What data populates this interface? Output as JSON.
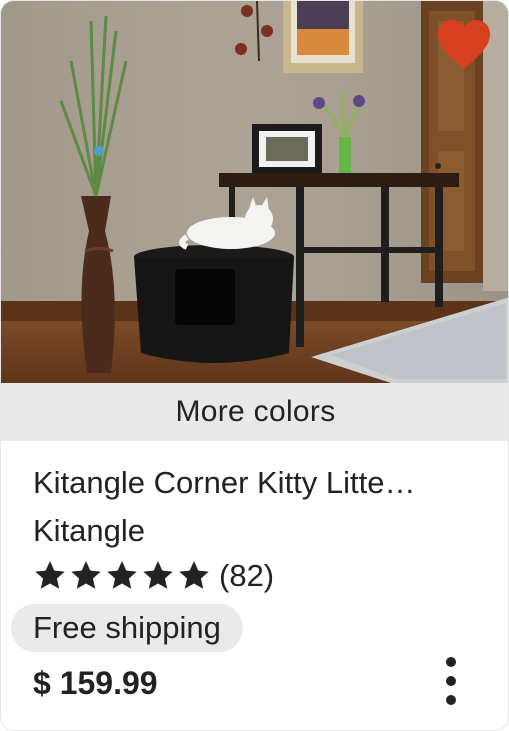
{
  "card": {
    "favorite_color": "#d6401f",
    "more_colors_label": "More colors",
    "title": "Kitangle Corner Kitty Litte…",
    "shop_name": "Kitangle",
    "rating": {
      "stars": 5,
      "count_label": "(82)"
    },
    "shipping_badge": "Free shipping",
    "price": "$ 159.99",
    "icons": {
      "favorite": "heart-icon",
      "star": "star-icon",
      "more": "more-vertical-icon"
    }
  }
}
